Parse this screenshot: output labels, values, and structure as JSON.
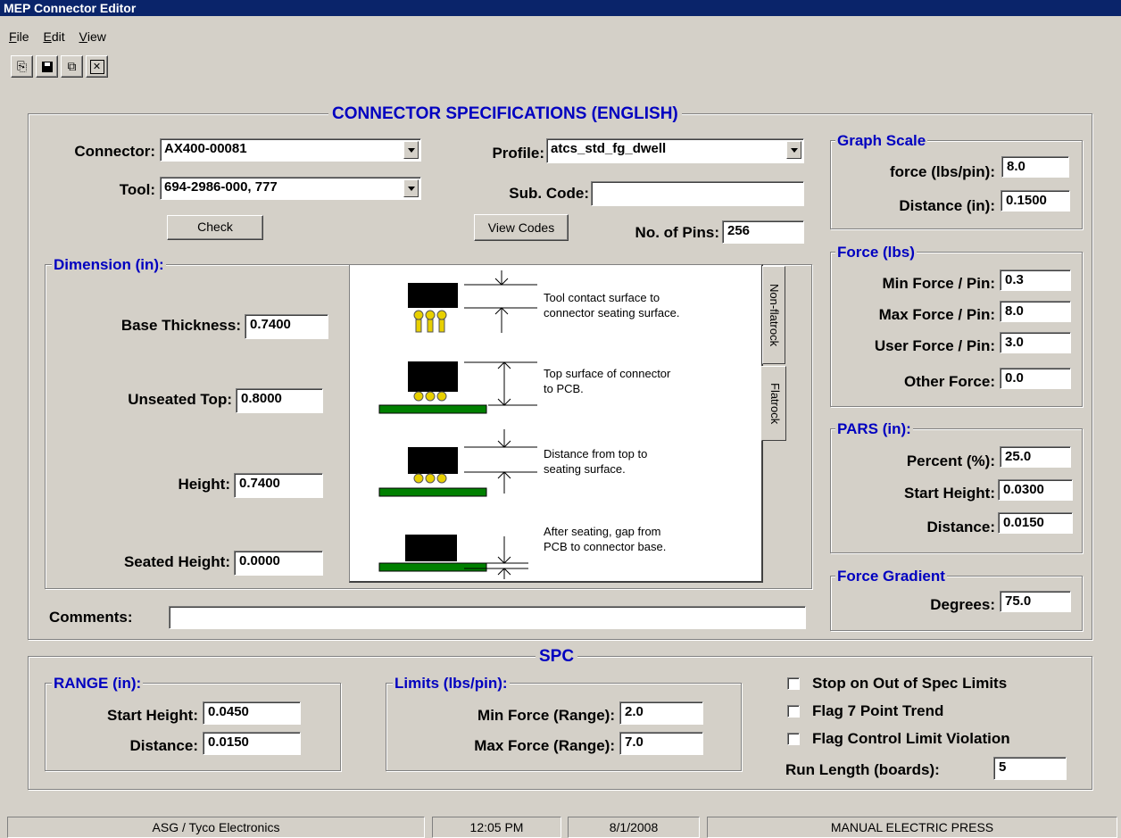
{
  "window": {
    "title": "MEP Connector Editor"
  },
  "menu": [
    {
      "accel": "F",
      "rest": "ile"
    },
    {
      "accel": "E",
      "rest": "dit"
    },
    {
      "accel": "V",
      "rest": "iew"
    }
  ],
  "toolbar": {
    "copy_icon": "⎘",
    "save_icon": "💾",
    "paste_icon": "⧉",
    "close_icon": "✕"
  },
  "specs": {
    "title": "CONNECTOR SPECIFICATIONS (ENGLISH)",
    "connector_label": "Connector:",
    "connector_value": "AX400-00081",
    "tool_label": "Tool:",
    "tool_value": "694-2986-000, 777",
    "check_label": "Check",
    "profile_label": "Profile:",
    "profile_value": "atcs_std_fg_dwell",
    "subcode_label": "Sub. Code:",
    "subcode_value": "",
    "view_codes_label": "View Codes",
    "pins_label": "No. of Pins:",
    "pins_value": "256",
    "comments_label": "Comments:",
    "comments_value": ""
  },
  "dimension": {
    "title": "Dimension (in):",
    "base_label": "Base Thickness:",
    "base_value": "0.7400",
    "unseated_label": "Unseated Top:",
    "unseated_value": "0.8000",
    "height_label": "Height:",
    "height_value": "0.7400",
    "seated_label": "Seated Height:",
    "seated_value": "0.0000",
    "desc1a": "Tool contact surface to",
    "desc1b": "connector seating surface.",
    "desc2a": "Top surface of connector",
    "desc2b": "to PCB.",
    "desc3a": "Distance from top to",
    "desc3b": "seating surface.",
    "desc4a": "After seating, gap from",
    "desc4b": "PCB to connector base.",
    "tab_nonflatrock": "Non-flatrock",
    "tab_flatrock": "Flatrock"
  },
  "graph_scale": {
    "title": "Graph Scale",
    "force_label": "force (lbs/pin):",
    "force_value": "8.0",
    "distance_label": "Distance (in):",
    "distance_value": "0.1500"
  },
  "force": {
    "title": "Force (lbs)",
    "min_label": "Min Force / Pin:",
    "min_value": "0.3",
    "max_label": "Max Force / Pin:",
    "max_value": "8.0",
    "user_label": "User Force / Pin:",
    "user_value": "3.0",
    "other_label": "Other Force:",
    "other_value": "0.0"
  },
  "pars": {
    "title": "PARS (in):",
    "percent_label": "Percent (%):",
    "percent_value": "25.0",
    "start_label": "Start Height:",
    "start_value": "0.0300",
    "distance_label": "Distance:",
    "distance_value": "0.0150"
  },
  "gradient": {
    "title": "Force Gradient",
    "degrees_label": "Degrees:",
    "degrees_value": "75.0"
  },
  "spc": {
    "title": "SPC",
    "range_title": "RANGE (in):",
    "range_start_label": "Start Height:",
    "range_start_value": "0.0450",
    "range_distance_label": "Distance:",
    "range_distance_value": "0.0150",
    "limits_title": "Limits (lbs/pin):",
    "min_force_label": "Min Force (Range):",
    "min_force_value": "2.0",
    "max_force_label": "Max Force (Range):",
    "max_force_value": "7.0",
    "stop_label": "Stop on Out of Spec Limits",
    "flag7_label": "Flag 7 Point Trend",
    "flagctrl_label": "Flag Control Limit Violation",
    "run_length_label": "Run Length (boards):",
    "run_length_value": "5"
  },
  "status": {
    "company": "ASG / Tyco Electronics",
    "time": "12:05 PM",
    "date": "8/1/2008",
    "mode": "MANUAL ELECTRIC PRESS"
  },
  "colors": {
    "accent": "#0000c0",
    "titlebar": "#0a246a",
    "pcb": "#008000",
    "connector": "#000000",
    "pins": "#e8d000"
  }
}
